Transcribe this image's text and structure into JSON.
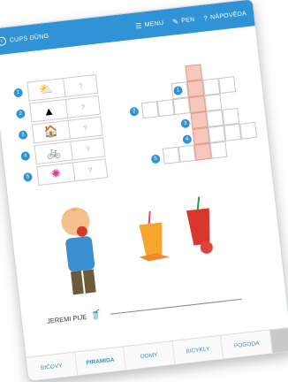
{
  "topbar": {
    "title": "CUPS DÜNG",
    "tool1": "MENU",
    "tool2": "PEN",
    "tool3": "NÁPOVĚDA"
  },
  "left_clues": [
    {
      "num": "1",
      "icon": "weather-icon",
      "answer": "?"
    },
    {
      "num": "2",
      "icon": "pyramid-icon",
      "answer": "?"
    },
    {
      "num": "3",
      "icon": "houses-icon",
      "answer": "?"
    },
    {
      "num": "4",
      "icon": "bicycles-icon",
      "answer": "?"
    },
    {
      "num": "5",
      "icon": "splash-icon",
      "answer": "?"
    }
  ],
  "crossword_numbers": [
    "1",
    "2",
    "3",
    "4",
    "5"
  ],
  "prompt": {
    "text": "JEREMI PIJE"
  },
  "tabs": [
    "BIČOVY",
    "PIRAMIDA",
    "DOMY",
    "BICYKLY",
    "POGODA"
  ],
  "colors": {
    "accent": "#2f93d6",
    "highlight": "#f6c8bd"
  }
}
